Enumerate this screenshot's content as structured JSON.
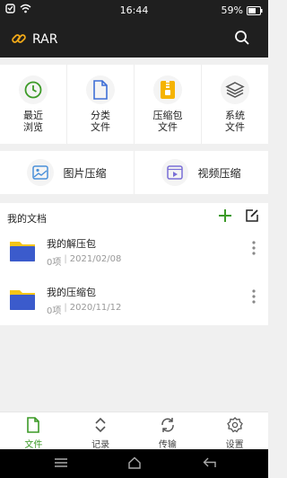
{
  "status_bar": {
    "time": "16:44",
    "battery": "59%"
  },
  "app_bar": {
    "title": "RAR",
    "logo_icon": "link-icon",
    "search_icon": "search-icon"
  },
  "categories": [
    {
      "label": "最近\n浏览",
      "icon": "clock-icon"
    },
    {
      "label": "分类\n文件",
      "icon": "file-icon"
    },
    {
      "label": "压缩包\n文件",
      "icon": "archive-icon"
    },
    {
      "label": "系统\n文件",
      "icon": "layers-icon"
    }
  ],
  "compress": [
    {
      "label": "图片压缩",
      "icon": "image-icon"
    },
    {
      "label": "视频压缩",
      "icon": "video-icon"
    }
  ],
  "my_docs": {
    "title": "我的文档",
    "items": [
      {
        "name": "我的解压包",
        "count": "0项",
        "date": "2021/02/08"
      },
      {
        "name": "我的压缩包",
        "count": "0项",
        "date": "2020/11/12"
      }
    ]
  },
  "bottom_nav": [
    {
      "label": "文件",
      "icon": "file-icon"
    },
    {
      "label": "记录",
      "icon": "sort-icon"
    },
    {
      "label": "传输",
      "icon": "sync-icon"
    },
    {
      "label": "设置",
      "icon": "gear-icon"
    }
  ],
  "colors": {
    "accent": "#3c9a27",
    "folder": "#3b5bcc",
    "folder_tab": "#f5c518",
    "appbar": "#1f1f1f"
  }
}
